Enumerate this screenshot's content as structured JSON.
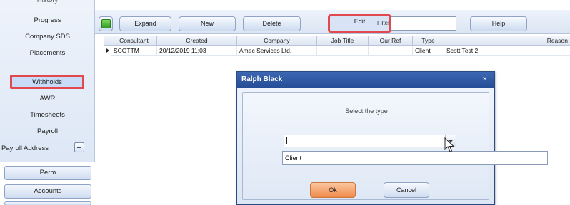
{
  "sidebar": {
    "cut_item": "History",
    "items": [
      {
        "label": "Progress"
      },
      {
        "label": "Company SDS"
      },
      {
        "label": "Placements"
      },
      {
        "label": "Withholds"
      },
      {
        "label": "AWR"
      },
      {
        "label": "Timesheets"
      },
      {
        "label": "Payroll"
      },
      {
        "label": "Payroll Address"
      }
    ],
    "buttons": [
      {
        "label": "Perm"
      },
      {
        "label": "Accounts"
      }
    ]
  },
  "toolbar": {
    "expand_label": "Expand",
    "new_label": "New",
    "delete_label": "Delete",
    "edit_label": "Edit",
    "filter_label": "Filter",
    "filter_value": "",
    "help_label": "Help"
  },
  "grid": {
    "columns": [
      "Consultant",
      "Created",
      "Company",
      "Job Title",
      "Our Ref",
      "Type",
      "Reason"
    ],
    "rows": [
      [
        "SCOTTM",
        "20/12/2019 11:03",
        "Amec Services Ltd.",
        "",
        "",
        "Client",
        "Scott Test 2"
      ]
    ]
  },
  "dialog": {
    "title": "Ralph Black",
    "close_glyph": "×",
    "prompt": "Select the type",
    "combo_value": "",
    "options": [
      "Client"
    ],
    "ok_label": "Ok",
    "cancel_label": "Cancel"
  },
  "colors": {
    "highlight": "#e2494e",
    "title_bar": "#2d5aa5",
    "ok_button": "#f08a4b"
  }
}
